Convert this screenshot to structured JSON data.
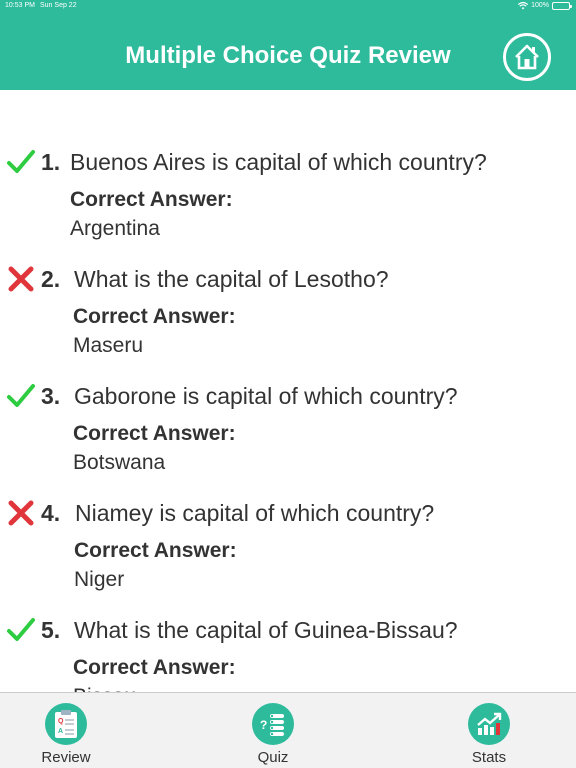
{
  "status_bar": {
    "time": "10:53 PM",
    "date": "Sun Sep 22",
    "battery": "100%"
  },
  "header": {
    "title": "Multiple Choice Quiz Review",
    "home_icon": "home-icon",
    "color": "#2dbb9c"
  },
  "questions": [
    {
      "number": "1.",
      "text": "Buenos Aires is capital of which country?",
      "correct": true,
      "answer_label": "Correct Answer:",
      "answer": "Argentina"
    },
    {
      "number": "2.",
      "text": "What is the capital of Lesotho?",
      "correct": false,
      "answer_label": "Correct Answer:",
      "answer": "Maseru"
    },
    {
      "number": "3.",
      "text": "Gaborone is capital of which country?",
      "correct": true,
      "answer_label": "Correct Answer:",
      "answer": "Botswana"
    },
    {
      "number": "4.",
      "text": "Niamey is capital of which country?",
      "correct": false,
      "answer_label": "Correct Answer:",
      "answer": "Niger"
    },
    {
      "number": "5.",
      "text": "What is the capital of Guinea-Bissau?",
      "correct": true,
      "answer_label": "Correct Answer:",
      "answer": "Bissau"
    }
  ],
  "tabs": [
    {
      "label": "Review",
      "icon": "review-icon"
    },
    {
      "label": "Quiz",
      "icon": "quiz-icon"
    },
    {
      "label": "Stats",
      "icon": "stats-icon"
    }
  ],
  "colors": {
    "correct": "#2ecc40",
    "wrong": "#e0353b",
    "accent": "#2dbb9c"
  }
}
